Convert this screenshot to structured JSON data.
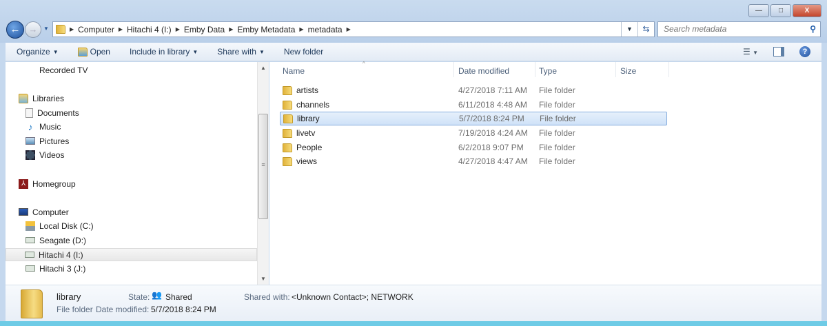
{
  "window": {
    "minimize": "—",
    "maximize": "□",
    "close": "X"
  },
  "address": {
    "crumbs": [
      "Computer",
      "Hitachi 4 (I:)",
      "Emby Data",
      "Emby Metadata",
      "metadata"
    ]
  },
  "search": {
    "placeholder": "Search metadata"
  },
  "toolbar": {
    "organize": "Organize",
    "open": "Open",
    "include": "Include in library",
    "share": "Share with",
    "new_folder": "New folder"
  },
  "nav": {
    "recorded_tv": "Recorded TV",
    "libraries": "Libraries",
    "documents": "Documents",
    "music": "Music",
    "pictures": "Pictures",
    "videos": "Videos",
    "homegroup": "Homegroup",
    "computer": "Computer",
    "local_disk": "Local Disk (C:)",
    "seagate": "Seagate (D:)",
    "hitachi4": "Hitachi 4 (I:)",
    "hitachi3": "Hitachi 3 (J:)"
  },
  "columns": {
    "name": "Name",
    "date": "Date modified",
    "type": "Type",
    "size": "Size"
  },
  "files": [
    {
      "name": "artists",
      "date": "4/27/2018 7:11 AM",
      "type": "File folder"
    },
    {
      "name": "channels",
      "date": "6/11/2018 4:48 AM",
      "type": "File folder"
    },
    {
      "name": "library",
      "date": "5/7/2018 8:24 PM",
      "type": "File folder"
    },
    {
      "name": "livetv",
      "date": "7/19/2018 4:24 AM",
      "type": "File folder"
    },
    {
      "name": "People",
      "date": "6/2/2018 9:07 PM",
      "type": "File folder"
    },
    {
      "name": "views",
      "date": "4/27/2018 4:47 AM",
      "type": "File folder"
    }
  ],
  "details": {
    "name": "library",
    "kind": "File folder",
    "date_label": "Date modified:",
    "date": "5/7/2018 8:24 PM",
    "state_label": "State:",
    "state": "Shared",
    "shared_label": "Shared with:",
    "shared_with": "<Unknown Contact>; NETWORK"
  }
}
